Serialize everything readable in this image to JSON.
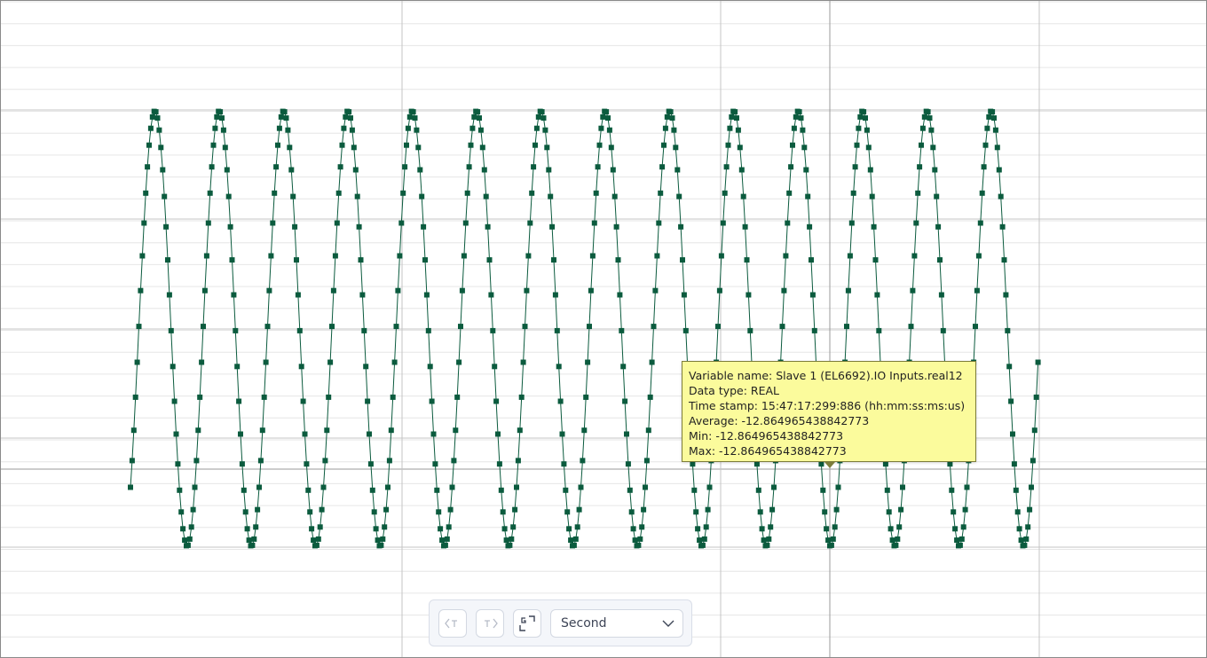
{
  "chart_data": {
    "type": "line",
    "title": "",
    "xlabel": "",
    "ylabel": "",
    "series": [
      {
        "name": "Slave 1 (EL6692).IO Inputs.real12",
        "shape": "sine",
        "cycles": 14,
        "start_x": 147,
        "period": 72.5,
        "min_value": -100,
        "max_value": 100,
        "points_per_cycle": 38
      }
    ],
    "grid": true,
    "color": "#0b5b3e"
  },
  "tooltip": {
    "variable_name": "Variable name: Slave 1 (EL6692).IO Inputs.real12",
    "data_type": "Data type: REAL",
    "time_stamp": "Time stamp: 15:47:17:299:886 (hh:mm:ss:ms:us)",
    "average": "Average: -12.864965438842773",
    "min": "Min: -12.864965438842773",
    "max": "Max: -12.864965438842773"
  },
  "toolbar": {
    "prev_icon": "prev-trigger-icon",
    "next_icon": "next-trigger-icon",
    "fit_icon": "fit-view-icon",
    "time_unit": "Second",
    "chevron_icon": "chevron-down-icon"
  },
  "colors": {
    "grid": "#e3e3e3",
    "grid_major": "#b8b8b8",
    "tooltip_bg": "#fbfb9c",
    "toolbar_bg": "#f4f6fa"
  }
}
